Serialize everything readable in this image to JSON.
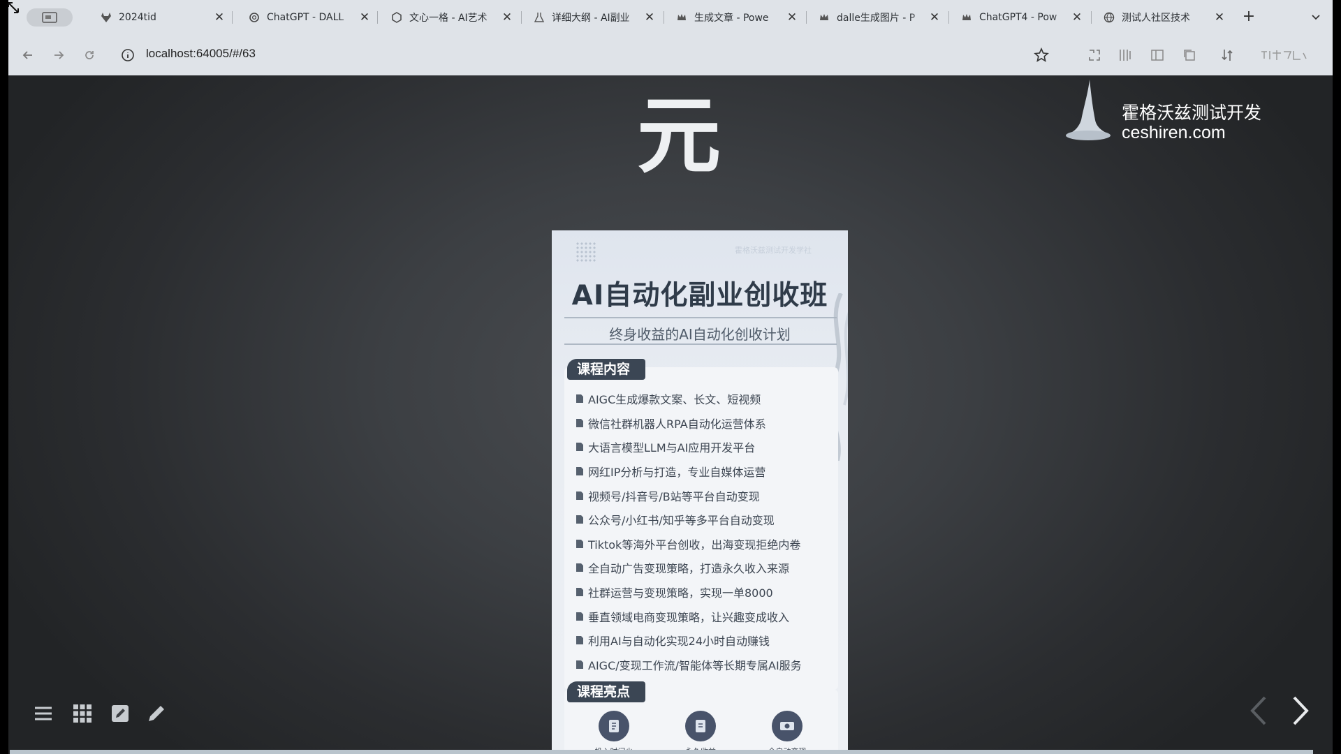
{
  "browser": {
    "tabs": [
      {
        "title": "2024tid",
        "icon": "gitlab-icon"
      },
      {
        "title": "ChatGPT - DALL",
        "icon": "chatgpt-icon"
      },
      {
        "title": "文心一格 - AI艺术",
        "icon": "wenxin-icon"
      },
      {
        "title": "详细大纲 - AI副业",
        "icon": "flask-icon"
      },
      {
        "title": "生成文章 - Powe",
        "icon": "crown-icon"
      },
      {
        "title": "dalle生成图片 - P",
        "icon": "crown-icon"
      },
      {
        "title": "ChatGPT4 - Pow",
        "icon": "crown-icon"
      },
      {
        "title": "测试人社区技术",
        "icon": "globe-icon"
      }
    ],
    "new_tab": "+",
    "address": "localhost:64005/#/63"
  },
  "slide": {
    "heading": "元",
    "brand": {
      "name": "霍格沃兹测试开发",
      "url": "ceshiren.com"
    },
    "poster": {
      "top_label": "霍格沃兹测试开发学社",
      "title": "AI自动化副业创收班",
      "subtitle": "终身收益的AI自动化创收计划",
      "courses_tag": "课程内容",
      "courses": [
        "AIGC生成爆款文案、长文、短视频",
        "微信社群机器人RPA自动化运营体系",
        "大语言模型LLM与AI应用开发平台",
        "网红IP分析与打造，专业自媒体运营",
        "视频号/抖音号/B站等平台自动变现",
        "公众号/小红书/知乎等多平台自动变现",
        "Tiktok等海外平台创收，出海变现拒绝内卷",
        "全自动广告变现策略，打造永久收入来源",
        "社群运营与变现策略，实现一单8000",
        "垂直领域电商变现策略，让兴趣变成收入",
        "利用AI与自动化实现24小时自动赚钱",
        "AIGC/变现工作流/智能体等长期专属AI服务"
      ],
      "highlights_tag": "课程亮点",
      "highlights": [
        "投入时间少",
        "永久收益",
        "全自动变现"
      ]
    }
  },
  "colors": {
    "chrome": "#dfe3e8",
    "stage": "#3c3f43",
    "poster_accent": "#3b4654"
  }
}
